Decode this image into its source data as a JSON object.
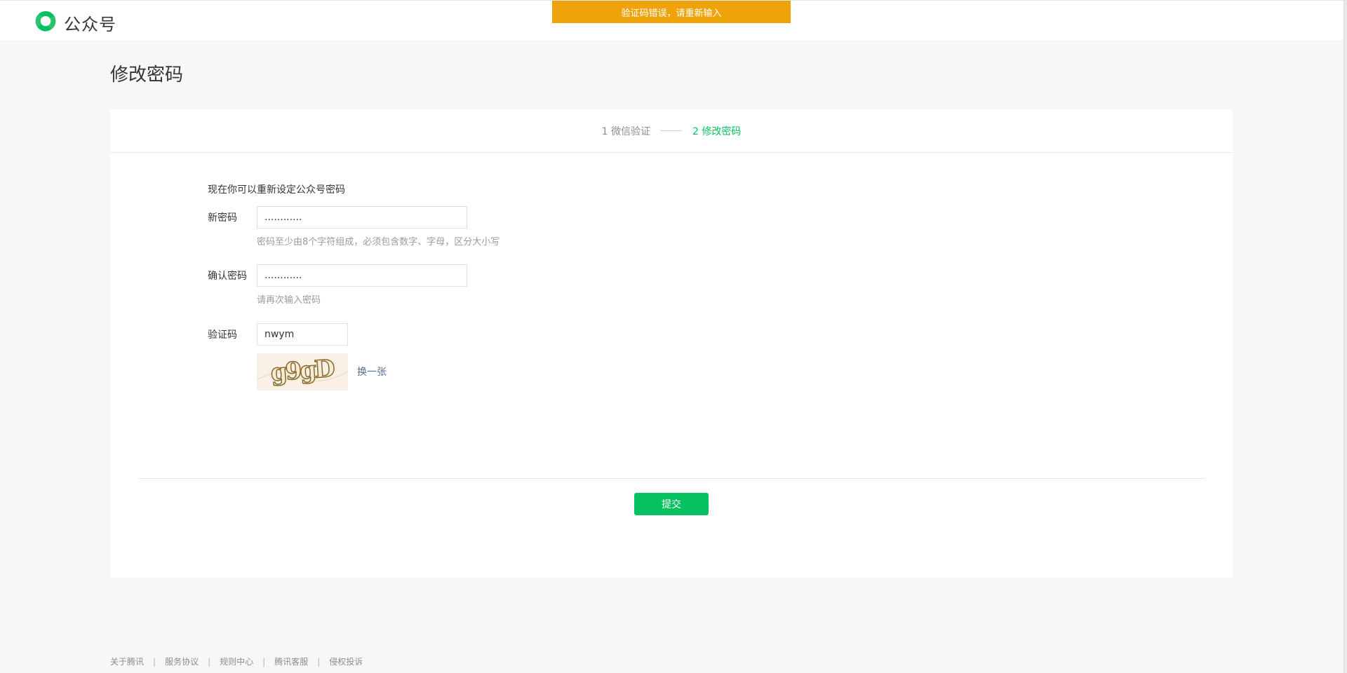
{
  "header": {
    "logo_icon": "wechat-official-account-logo-icon",
    "brand_name": "公众号"
  },
  "toast": {
    "message": "验证码错误，请重新输入",
    "color": "#eea30b"
  },
  "page": {
    "title": "修改密码"
  },
  "steps": [
    {
      "label": "1 微信验证",
      "active": false
    },
    {
      "label": "2 修改密码",
      "active": true
    }
  ],
  "form": {
    "intro": "现在你可以重新设定公众号密码",
    "new_password": {
      "label": "新密码",
      "value": "............",
      "hint": "密码至少由8个字符组成，必须包含数字、字母，区分大小写"
    },
    "confirm_password": {
      "label": "确认密码",
      "value": "............",
      "hint": "请再次输入密码"
    },
    "captcha": {
      "label": "验证码",
      "value": "nwym",
      "image_text": "g9gD",
      "refresh_label": "换一张"
    },
    "submit_label": "提交"
  },
  "footer": {
    "links": [
      "关于腾讯",
      "服务协议",
      "规则中心",
      "腾讯客服",
      "侵权投诉"
    ]
  },
  "colors": {
    "accent": "#07c160",
    "link": "#576b95",
    "warning": "#eea30b"
  }
}
